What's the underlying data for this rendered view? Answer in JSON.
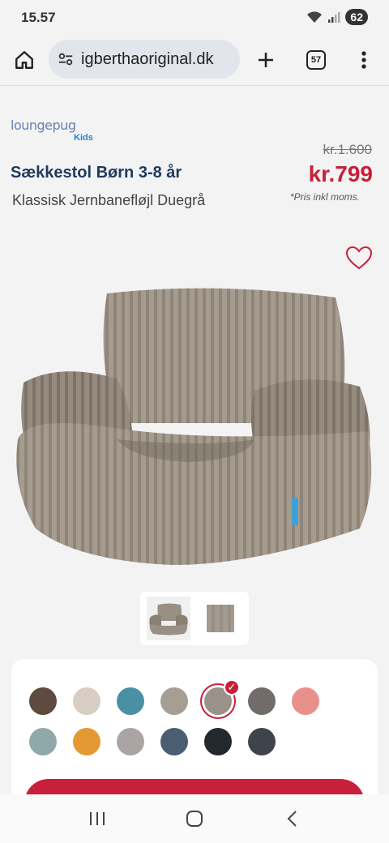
{
  "status": {
    "time": "15.57",
    "battery": "62"
  },
  "browser": {
    "url": "igberthaoriginal.dk",
    "tab_count": "57"
  },
  "brand": {
    "logo_text": "loungepug",
    "logo_sub": "Kids"
  },
  "product": {
    "title": "Sækkestol Børn 3-8 år",
    "subtitle": "Klassisk Jernbanefløjl Duegrå",
    "price_old": "kr.1.600",
    "price_new": "kr.799",
    "price_note": "*Pris inkl moms."
  },
  "swatches": [
    {
      "color": "#5e4a3e",
      "selected": false
    },
    {
      "color": "#d7cdc2",
      "selected": false
    },
    {
      "color": "#4a90a4",
      "selected": false
    },
    {
      "color": "#a59e92",
      "selected": false
    },
    {
      "color": "#9a918a",
      "selected": true
    },
    {
      "color": "#716b69",
      "selected": false
    },
    {
      "color": "#e8918c",
      "selected": false
    },
    {
      "color": "#8fa9ab",
      "selected": false
    },
    {
      "color": "#e39a33",
      "selected": false
    },
    {
      "color": "#aca4a4",
      "selected": false
    },
    {
      "color": "#4a5e72",
      "selected": false
    },
    {
      "color": "#23272e",
      "selected": false
    },
    {
      "color": "#3f444c",
      "selected": false
    }
  ],
  "colors": {
    "accent": "#c8203a",
    "title": "#1e3a5f"
  }
}
